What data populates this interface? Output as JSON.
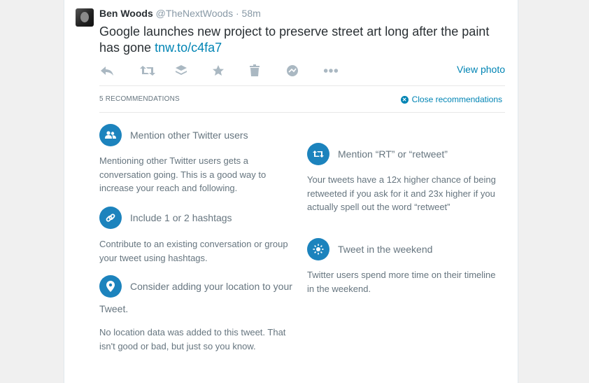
{
  "tweet": {
    "name": "Ben Woods",
    "handle": "@TheNextWoods",
    "separator": "·",
    "time": "58m",
    "text": "Google launches new project to preserve street art long after the paint has gone ",
    "link": "tnw.to/c4fa7",
    "view_photo": "View photo"
  },
  "actions": [
    "reply-icon",
    "retweet-icon",
    "stack-icon",
    "favorite-icon",
    "delete-icon",
    "analytics-icon",
    "more-icon"
  ],
  "recommendations": {
    "count_label": "5 RECOMMENDATIONS",
    "close_label": "Close recommendations",
    "items": [
      {
        "title": "Mention other Twitter users",
        "body": "Mentioning other Twitter users gets a conversation going. This is a good way to increase your reach and following."
      },
      {
        "title": "Include 1 or 2 hashtags",
        "body": "Contribute to an existing conversation or group your tweet using hashtags."
      },
      {
        "title": "Consider adding your location to your",
        "title_cont": "Tweet.",
        "body": "No location data was added to this tweet. That isn't good or bad, but just so you know."
      },
      {
        "title": "Mention “RT” or “retweet”",
        "body": "Your tweets have a 12x higher chance of being retweeted if you ask for it and 23x higher if you actually spell out the word “retweet”"
      },
      {
        "title": "Tweet in the weekend",
        "body": "Twitter users spend more time on their timeline in the weekend."
      }
    ]
  },
  "colors": {
    "accent": "#0084b4",
    "icon_circle": "#1c83bd",
    "muted": "#66757f",
    "action_icon": "#aab8c2"
  }
}
